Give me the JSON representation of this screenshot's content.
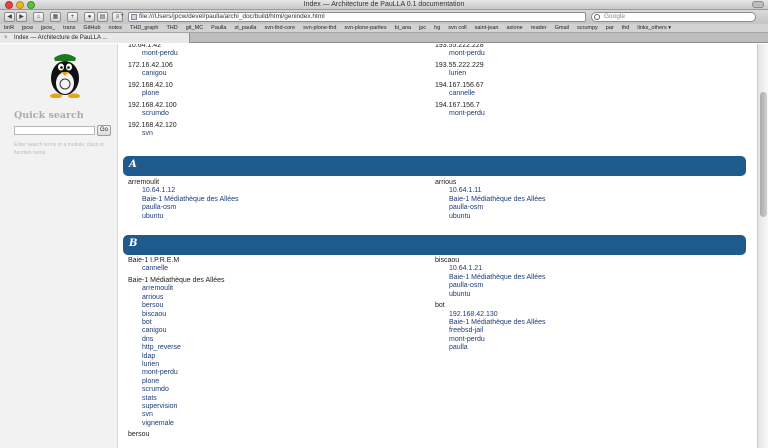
{
  "window": {
    "title": "Index — Architecture de PauLLA 0.1 documentation"
  },
  "toolbar": {
    "back_icon": "back-arrow-icon",
    "forward_icon": "forward-arrow-icon",
    "address": "file:///Users/jpcw/devel/paulla/archi_doc/build/html/genindex.html",
    "search_placeholder": "Google"
  },
  "bookmarks": [
    "bnR",
    "jpcw",
    "jpcw_",
    "trans",
    "GitHub",
    "notes",
    "THD_graph",
    "THD",
    "git_MC",
    "Paulla",
    "st_paulla",
    "svn-thd-core",
    "svn-plone-thd",
    "svn-plone-parites",
    "bi_ana",
    "jpc",
    "hg",
    "svn coll",
    "saint-jean",
    "axione",
    "reader",
    "Gmail",
    "scrumpy",
    "par",
    "thd",
    "links_others ▾"
  ],
  "tab": {
    "label": "Index — Architecture de PauLLA ..."
  },
  "sidebar": {
    "quick_search_title": "Quick search",
    "go_label": "Go",
    "hint": "Enter search terms or a module, class or function name."
  },
  "top_entries": {
    "left": [
      {
        "term": "10.64.1.42",
        "subs": [
          "mont-perdu"
        ]
      },
      {
        "term": "172.16.42.106",
        "subs": [
          "canigou"
        ]
      },
      {
        "term": "192.168.42.10",
        "subs": [
          "plone"
        ]
      },
      {
        "term": "192.168.42.100",
        "subs": [
          "scrumdo"
        ]
      },
      {
        "term": "192.168.42.120",
        "subs": [
          "svn"
        ]
      }
    ],
    "right": [
      {
        "term": "193.55.222.228",
        "subs": [
          "mont-perdu"
        ]
      },
      {
        "term": "193.55.222.229",
        "subs": [
          "lurien"
        ]
      },
      {
        "term": "194.167.156.67",
        "subs": [
          "cannelle"
        ]
      },
      {
        "term": "194.167.156.7",
        "subs": [
          "mont-perdu"
        ]
      }
    ]
  },
  "section_a": {
    "letter": "A",
    "left": [
      {
        "term": "arremoulit",
        "subs": [
          "10.64.1.12",
          "Baie-1 Médiathèque des Allées",
          "paulla-osm",
          "ubuntu"
        ]
      }
    ],
    "right": [
      {
        "term": "arrious",
        "subs": [
          "10.64.1.11",
          "Baie-1 Médiathèque des Allées",
          "paulla-osm",
          "ubuntu"
        ]
      }
    ]
  },
  "section_b": {
    "letter": "B",
    "left": [
      {
        "term": "Baie-1 I.P.R.E.M",
        "subs": [
          "cannelle"
        ]
      },
      {
        "term": "Baie-1 Médiathèque des Allées",
        "subs": [
          "arremoulit",
          "arrious",
          "bersou",
          "biscaou",
          "bot",
          "canigou",
          "dns",
          "http_reverse",
          "ldap",
          "lurien",
          "mont-perdu",
          "plone",
          "scrumdo",
          "stats",
          "supervision",
          "svn",
          "vignemale"
        ]
      },
      {
        "term": "bersou",
        "subs": []
      }
    ],
    "right": [
      {
        "term": "biscaou",
        "subs": [
          "10.64.1.21",
          "Baie-1 Médiathèque des Allées",
          "paulla-osm",
          "ubuntu"
        ]
      },
      {
        "term": "bot",
        "subs": [
          "192.168.42.130",
          "Baie-1 Médiathèque des Allées",
          "freebsd-jail",
          "mont-perdu",
          "paulla"
        ]
      }
    ]
  }
}
